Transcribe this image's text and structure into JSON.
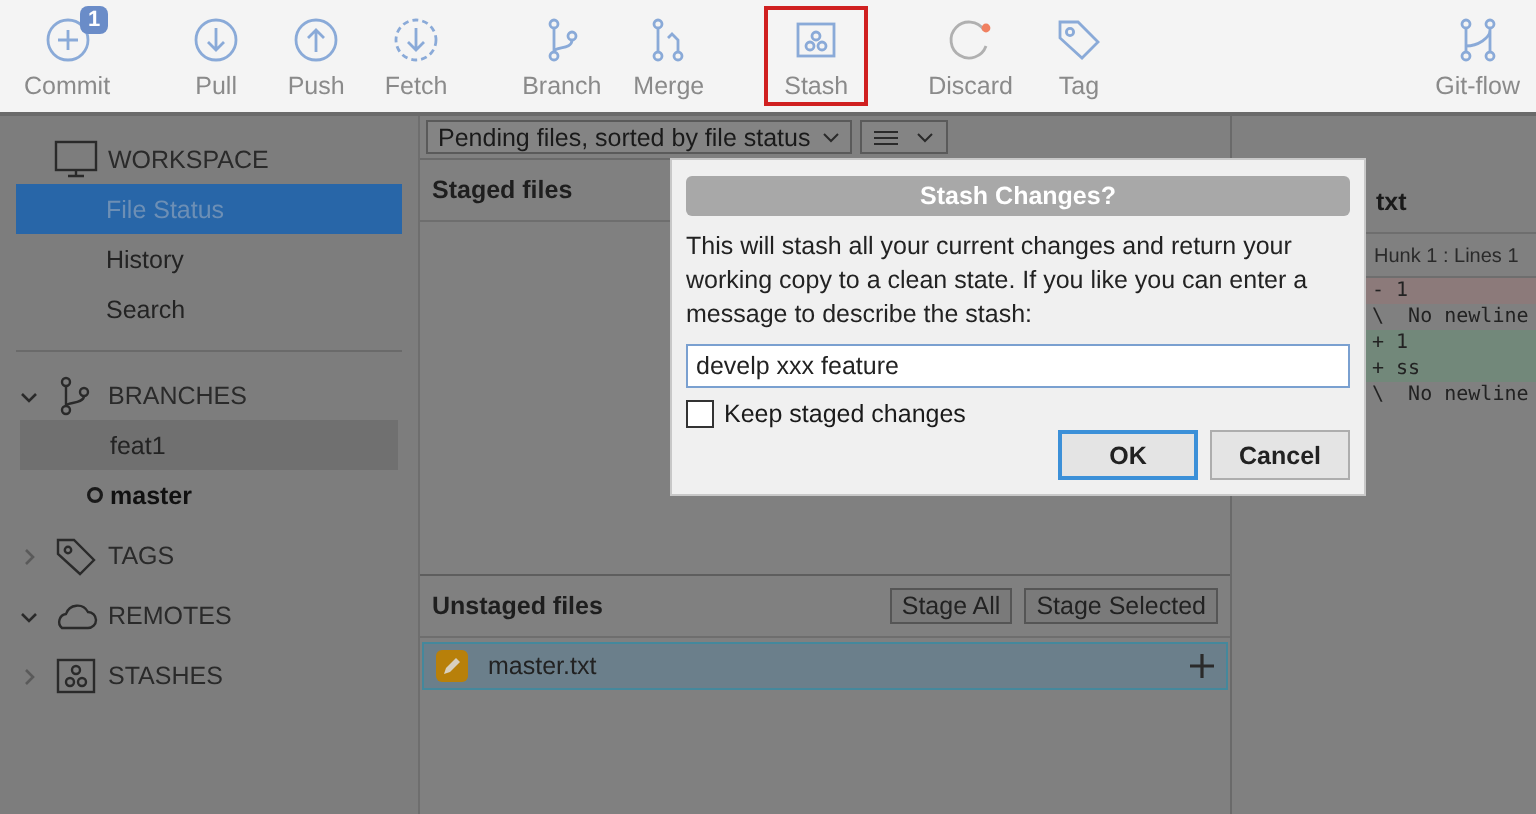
{
  "toolbar": {
    "items": [
      {
        "label": "Commit",
        "badge": "1",
        "highlighted": false
      },
      {
        "label": "Pull",
        "highlighted": false
      },
      {
        "label": "Push",
        "highlighted": false
      },
      {
        "label": "Fetch",
        "highlighted": false
      },
      {
        "label": "Branch",
        "highlighted": false
      },
      {
        "label": "Merge",
        "highlighted": false
      },
      {
        "label": "Stash",
        "highlighted": true
      },
      {
        "label": "Discard",
        "highlighted": false
      },
      {
        "label": "Tag",
        "highlighted": false
      },
      {
        "label": "Git-flow",
        "highlighted": false
      }
    ]
  },
  "sidebar": {
    "sections": [
      {
        "kind": "workspace",
        "title": "WORKSPACE",
        "items": [
          {
            "label": "File Status",
            "selected": true
          },
          {
            "label": "History",
            "selected": false
          },
          {
            "label": "Search",
            "selected": false
          }
        ]
      },
      {
        "kind": "group",
        "title": "BRANCHES",
        "expanded": true,
        "items": [
          {
            "label": "feat1",
            "selected": true,
            "current": false
          },
          {
            "label": "master",
            "selected": false,
            "current": true
          }
        ]
      },
      {
        "kind": "group",
        "title": "TAGS",
        "expanded": false
      },
      {
        "kind": "group",
        "title": "REMOTES",
        "expanded": true
      },
      {
        "kind": "group",
        "title": "STASHES",
        "expanded": false
      }
    ]
  },
  "files": {
    "sort_dropdown": "Pending files, sorted by file status",
    "staged_title": "Staged files",
    "unstaged_title": "Unstaged files",
    "buttons": [
      "Stage All",
      "Stage Selected"
    ],
    "unstaged": [
      {
        "name": "master.txt",
        "selected": true
      }
    ]
  },
  "diff": {
    "title": "txt",
    "hunk": "Hunk 1 : Lines 1",
    "lines": [
      {
        "kind": "removed",
        "text": "- 1"
      },
      {
        "kind": "note",
        "text": "\\  No newline"
      },
      {
        "kind": "added",
        "text": "+ 1"
      },
      {
        "kind": "added",
        "text": "+ ss"
      },
      {
        "kind": "note",
        "text": "\\  No newline"
      }
    ]
  },
  "dialog": {
    "title": "Stash Changes?",
    "message": "This will stash all your current changes and return your working copy to a clean state. If you like you can enter a message to describe the stash:",
    "value": "develp xxx feature",
    "keep_staged": {
      "label": "Keep staged changes",
      "checked": false
    },
    "ok": "OK",
    "cancel": "Cancel"
  }
}
